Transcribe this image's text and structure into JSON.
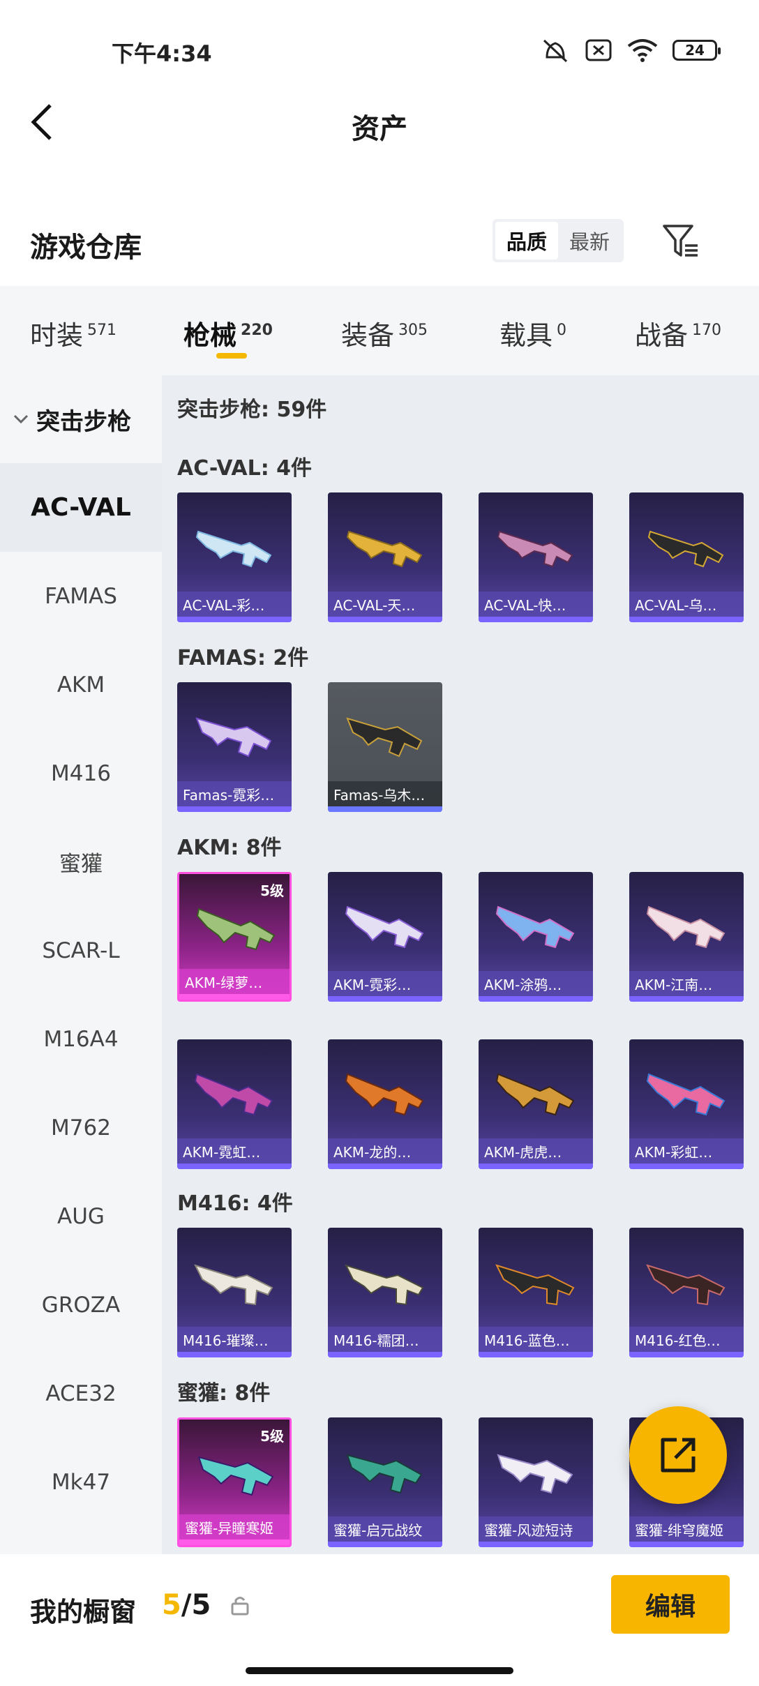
{
  "status_bar": {
    "time": "下午4:34",
    "battery": "24"
  },
  "header": {
    "title": "资产"
  },
  "warehouse": {
    "title": "游戏仓库",
    "sort_options": [
      "品质",
      "最新"
    ],
    "active_sort": "品质"
  },
  "tabs": [
    {
      "label": "时装",
      "count": "571"
    },
    {
      "label": "枪械",
      "count": "220"
    },
    {
      "label": "装备",
      "count": "305"
    },
    {
      "label": "载具",
      "count": "0"
    },
    {
      "label": "战备",
      "count": "170"
    }
  ],
  "sidebar": {
    "category": "突击步枪",
    "items": [
      "AC-VAL",
      "FAMAS",
      "AKM",
      "M416",
      "蜜獾",
      "SCAR-L",
      "M16A4",
      "M762",
      "AUG",
      "GROZA",
      "ACE32",
      "Mk47"
    ]
  },
  "content": {
    "summary": "突击步枪: 59件",
    "sections": [
      {
        "label": "AC-VAL: 4件",
        "items": [
          "AC-VAL-彩…",
          "AC-VAL-天…",
          "AC-VAL-快…",
          "AC-VAL-乌…"
        ]
      },
      {
        "label": "FAMAS: 2件",
        "items": [
          "Famas-霓彩…",
          "Famas-乌木…"
        ]
      },
      {
        "label": "AKM: 8件",
        "items": [
          "AKM-绿萝…",
          "AKM-霓彩…",
          "AKM-涂鸦…",
          "AKM-江南…",
          "AKM-霓虹…",
          "AKM-龙的…",
          "AKM-虎虎…",
          "AKM-彩虹…"
        ]
      },
      {
        "label": "M416: 4件",
        "items": [
          "M416-璀璨…",
          "M416-糯团…",
          "M416-蓝色…",
          "M416-红色…"
        ]
      },
      {
        "label": "蜜獾: 8件",
        "items": [
          "蜜獾-异瞳寒姬",
          "蜜獾-启元战纹",
          "蜜獾-风迹短诗",
          "蜜獾-绯穹魔姬"
        ]
      }
    ],
    "level_badge": "5级"
  },
  "bottom_bar": {
    "label": "我的橱窗",
    "current": "5",
    "total": "/5",
    "edit": "编辑"
  },
  "colors": {
    "accent": "#f7b500",
    "card_purple": "#3b2f73",
    "card_pink": "#d641c8"
  }
}
